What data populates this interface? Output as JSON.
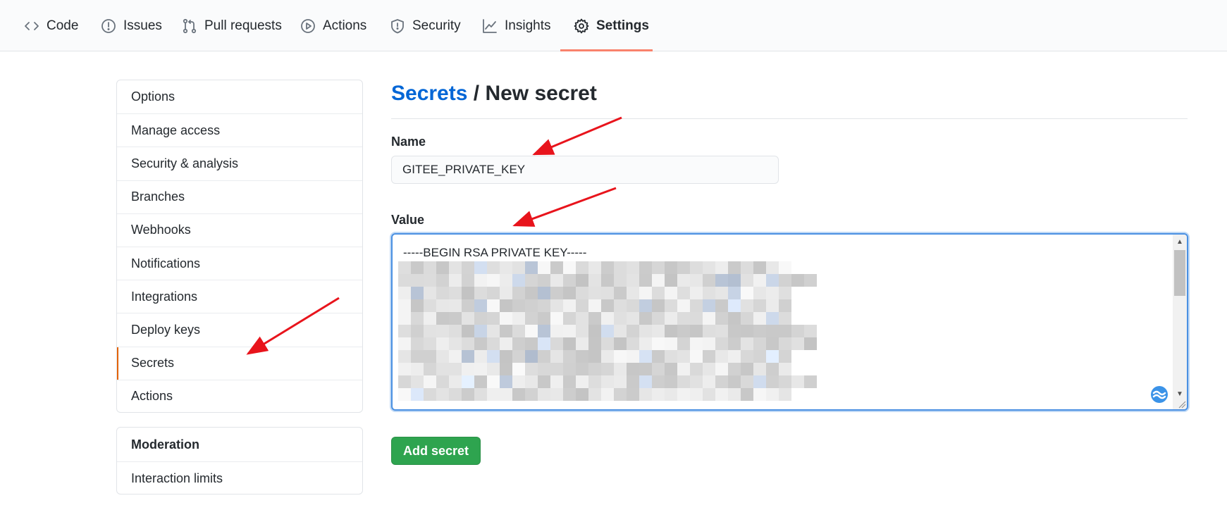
{
  "nav": {
    "tabs": [
      {
        "label": "Code",
        "icon": "code-icon"
      },
      {
        "label": "Issues",
        "icon": "issue-icon"
      },
      {
        "label": "Pull requests",
        "icon": "pull-request-icon"
      },
      {
        "label": "Actions",
        "icon": "play-icon"
      },
      {
        "label": "Security",
        "icon": "shield-icon"
      },
      {
        "label": "Insights",
        "icon": "graph-icon"
      },
      {
        "label": "Settings",
        "icon": "gear-icon",
        "selected": true
      }
    ]
  },
  "sidebar": {
    "items": [
      "Options",
      "Manage access",
      "Security & analysis",
      "Branches",
      "Webhooks",
      "Notifications",
      "Integrations",
      "Deploy keys",
      "Secrets",
      "Actions"
    ],
    "selected": "Secrets",
    "moderation": {
      "heading": "Moderation",
      "items": [
        "Interaction limits"
      ]
    }
  },
  "main": {
    "breadcrumb_link": "Secrets",
    "breadcrumb_separator": " / ",
    "page_title": "New secret",
    "name_label": "Name",
    "name_value": "GITEE_PRIVATE_KEY",
    "value_label": "Value",
    "value_first_line": "-----BEGIN RSA PRIVATE KEY-----",
    "submit_label": "Add secret"
  },
  "colors": {
    "link": "#0366d6",
    "primary_button": "#2ea44f",
    "selected_tab_underline": "#f9826c",
    "annotation_arrow": "#e8141c",
    "focus_border": "#4a90e2"
  }
}
